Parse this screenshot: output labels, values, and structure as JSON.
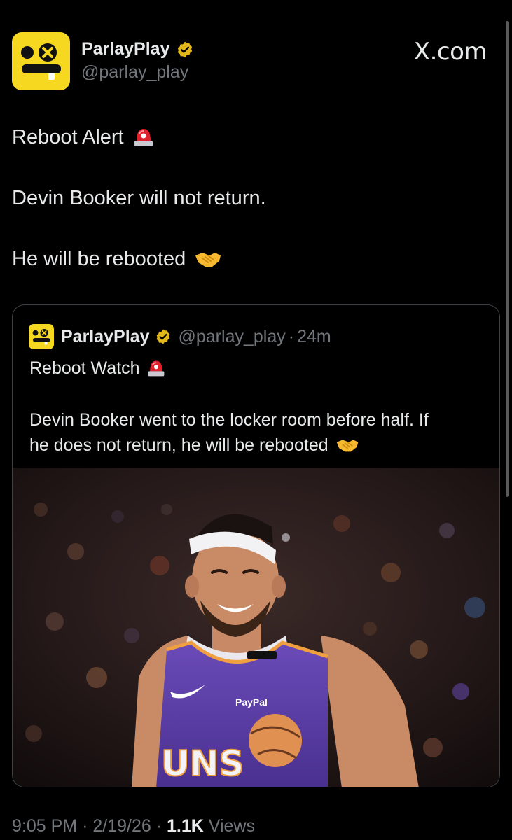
{
  "header": {
    "display_name": "ParlayPlay",
    "handle": "@parlay_play",
    "site_label": "X.com"
  },
  "tweet": {
    "line1": "Reboot Alert",
    "line2": "Devin Booker will not return.",
    "line3": "He will be rebooted",
    "line1_emoji": "police-light-icon",
    "line3_emoji": "handshake-icon"
  },
  "quote": {
    "display_name": "ParlayPlay",
    "handle": "@parlay_play",
    "separator": "·",
    "time": "24m",
    "line1": "Reboot Watch",
    "line2": "Devin Booker went to the locker room before half. If",
    "line3": "he does not return, he will be rebooted",
    "jersey_sponsor": "PayPal",
    "jersey_text": "UNS"
  },
  "footer": {
    "time": "9:05 PM",
    "date": "2/19/26",
    "views_count": "1.1K",
    "views_label": "Views"
  },
  "colors": {
    "background": "#000000",
    "brand_yellow": "#f5d81f",
    "verified_gold": "#e2b719",
    "secondary_text": "#71767b",
    "jersey_purple": "#5a3fa0"
  }
}
